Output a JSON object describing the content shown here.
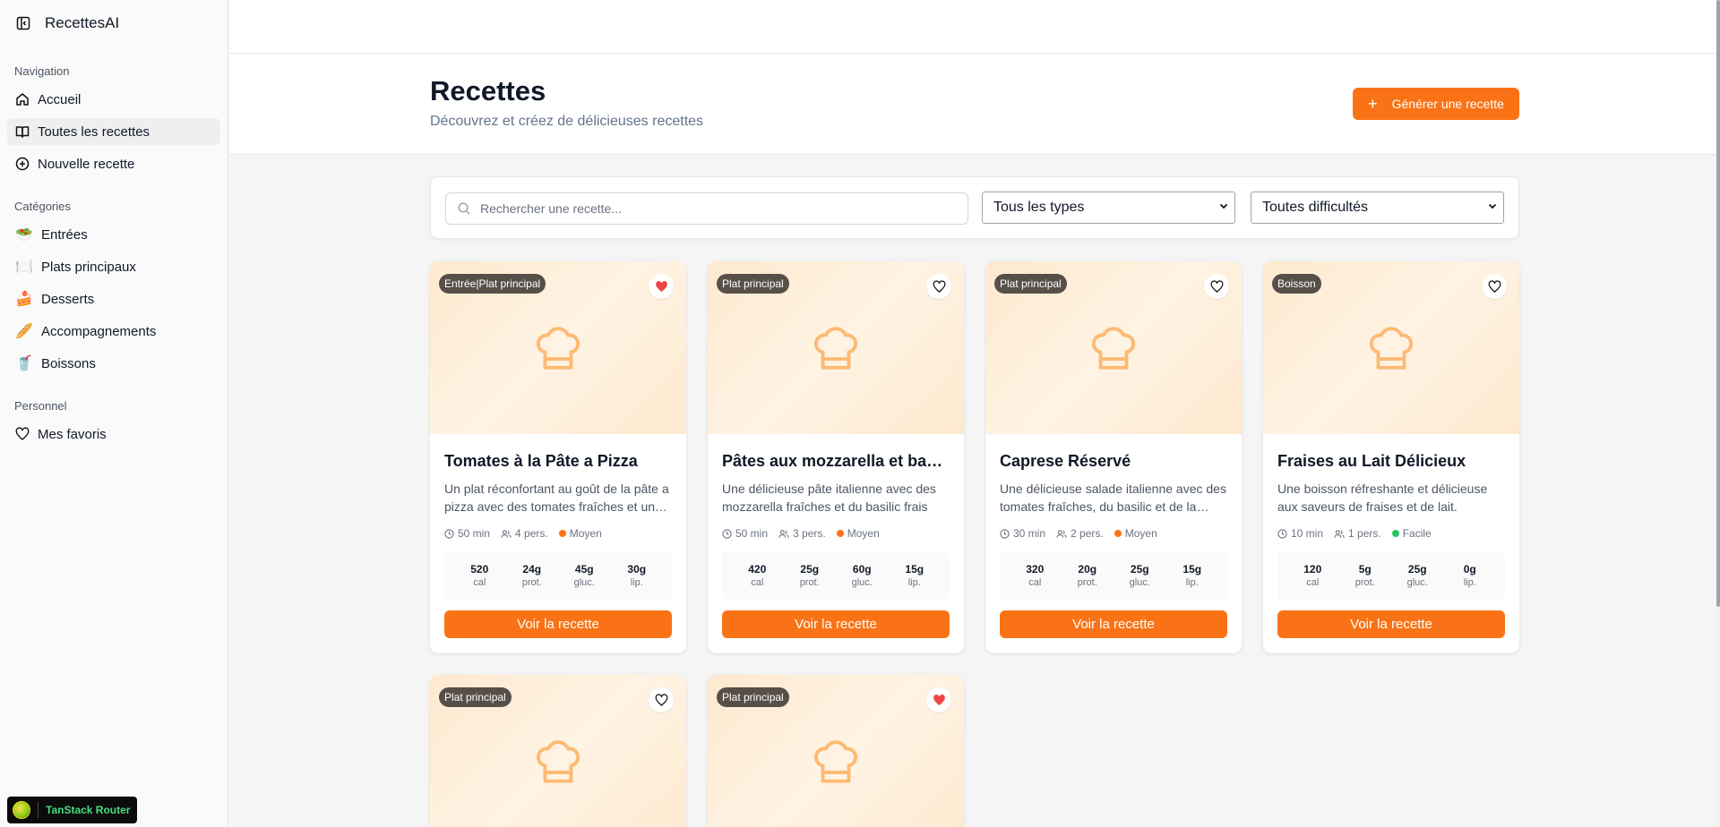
{
  "app": {
    "name": "RecettesAI"
  },
  "sidebar": {
    "navigation_label": "Navigation",
    "nav": [
      {
        "label": "Accueil",
        "icon": "home-icon"
      },
      {
        "label": "Toutes les recettes",
        "icon": "book-icon",
        "active": true
      },
      {
        "label": "Nouvelle recette",
        "icon": "plus-circle-icon"
      }
    ],
    "categories_label": "Catégories",
    "categories": [
      {
        "label": "Entrées",
        "emoji": "🥗"
      },
      {
        "label": "Plats principaux",
        "emoji": "🍽️"
      },
      {
        "label": "Desserts",
        "emoji": "🍰"
      },
      {
        "label": "Accompagnements",
        "emoji": "🥖"
      },
      {
        "label": "Boissons",
        "emoji": "🥤"
      }
    ],
    "personal_label": "Personnel",
    "personal": [
      {
        "label": "Mes favoris",
        "icon": "heart-icon"
      }
    ]
  },
  "header": {
    "title": "Recettes",
    "subtitle": "Découvrez et créez de délicieuses recettes",
    "generate_label": "Générer une recette"
  },
  "filters": {
    "search_placeholder": "Rechercher une recette...",
    "type_value": "Tous les types",
    "difficulty_value": "Toutes difficultés"
  },
  "cards": [
    {
      "badge": "Entrée|Plat principal",
      "favorite": true,
      "title": "Tomates à la Pâte a Pizza",
      "description": "Un plat réconfortant au goût de la pâte a pizza avec des tomates fraîches et une touche de basilic.",
      "time": "50 min",
      "servings": "4 pers.",
      "difficulty": "Moyen",
      "difficulty_color": "#f97316",
      "cal": "520",
      "prot": "24g",
      "gluc": "45g",
      "lip": "30g"
    },
    {
      "badge": "Plat principal",
      "favorite": false,
      "title": "Pâtes aux mozzarella et basilic",
      "description": "Une délicieuse pâte italienne avec des mozzarella fraîches et du basilic frais",
      "time": "50 min",
      "servings": "3 pers.",
      "difficulty": "Moyen",
      "difficulty_color": "#f97316",
      "cal": "420",
      "prot": "25g",
      "gluc": "60g",
      "lip": "15g"
    },
    {
      "badge": "Plat principal",
      "favorite": false,
      "title": "Caprese Réservé",
      "description": "Une délicieuse salade italienne avec des tomates fraîches, du basilic et de la mozzarella.",
      "time": "30 min",
      "servings": "2 pers.",
      "difficulty": "Moyen",
      "difficulty_color": "#f97316",
      "cal": "320",
      "prot": "20g",
      "gluc": "25g",
      "lip": "15g"
    },
    {
      "badge": "Boisson",
      "favorite": false,
      "title": "Fraises au Lait Délicieux",
      "description": "Une boisson réfreshante et délicieuse aux saveurs de fraises et de lait.",
      "time": "10 min",
      "servings": "1 pers.",
      "difficulty": "Facile",
      "difficulty_color": "#22c55e",
      "cal": "120",
      "prot": "5g",
      "gluc": "25g",
      "lip": "0g"
    },
    {
      "badge": "Plat principal",
      "favorite": false
    },
    {
      "badge": "Plat principal",
      "favorite": true
    }
  ],
  "labels": {
    "cal": "cal",
    "prot": "prot.",
    "gluc": "gluc.",
    "lip": "lip.",
    "view_recipe": "Voir la recette"
  },
  "devtools": {
    "label": "TanStack Router"
  },
  "colors": {
    "accent": "#f97316",
    "favorite": "#ef4444",
    "easy": "#22c55e",
    "medium": "#f97316"
  }
}
